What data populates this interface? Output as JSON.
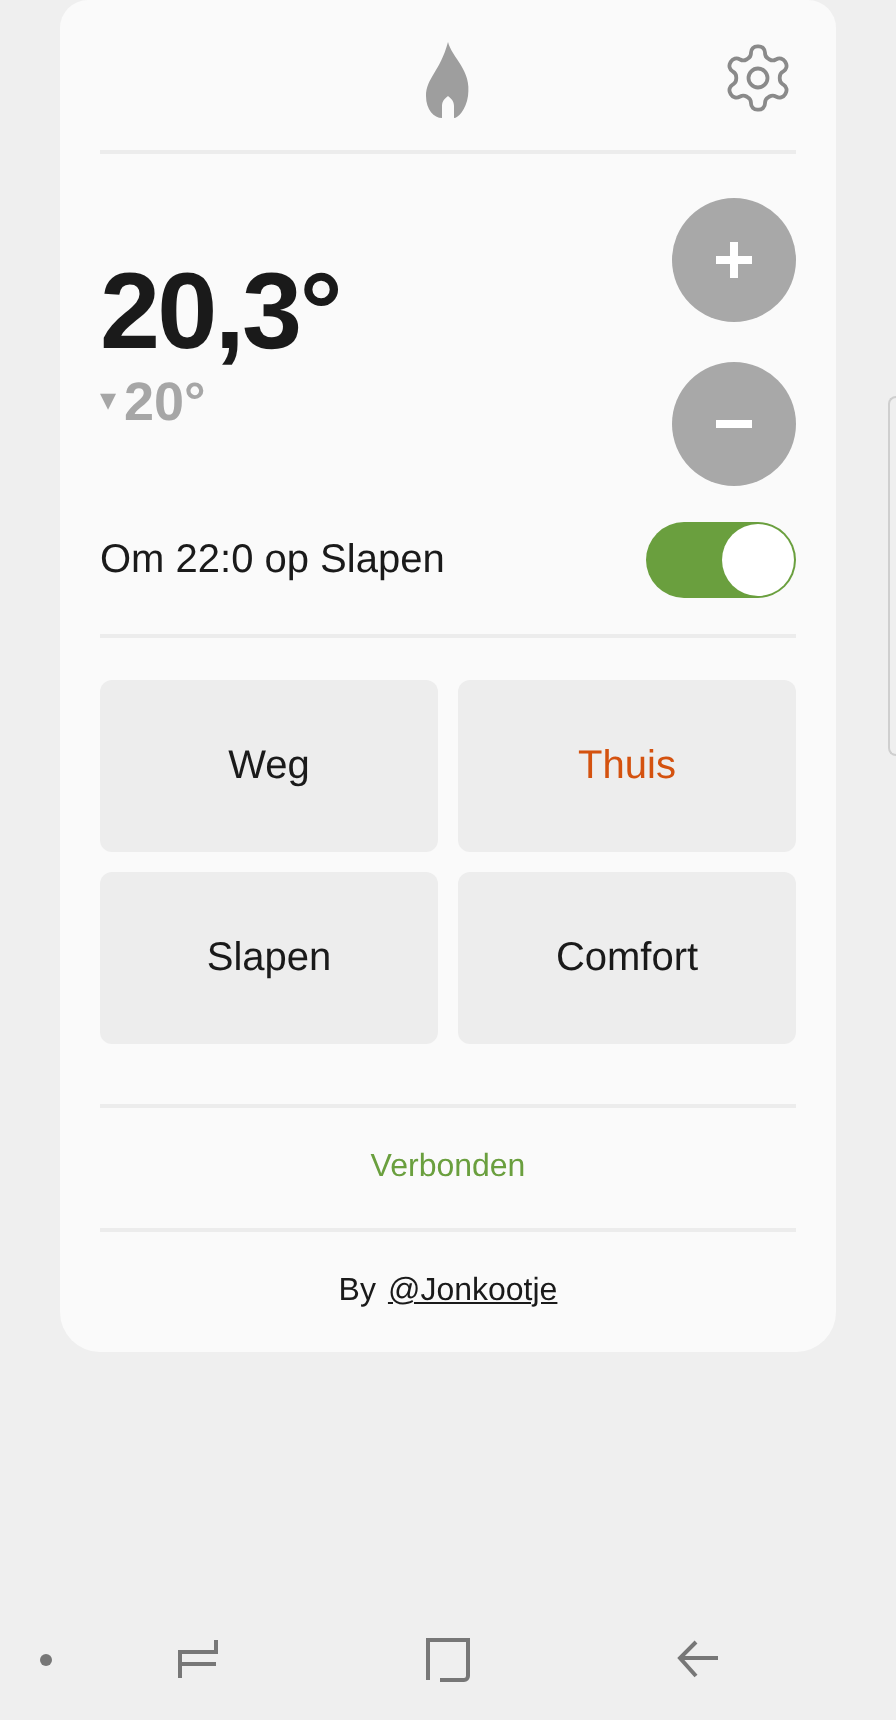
{
  "temperature": "20,3°",
  "setpoint": {
    "arrow": "▾",
    "value": "20°"
  },
  "schedule": {
    "label": "Om 22:0 op Slapen",
    "on": true
  },
  "modes": [
    {
      "label": "Weg",
      "selected": false
    },
    {
      "label": "Thuis",
      "selected": true
    },
    {
      "label": "Slapen",
      "selected": false
    },
    {
      "label": "Comfort",
      "selected": false
    }
  ],
  "status": "Verbonden",
  "credit": {
    "prefix": "By",
    "link": "@Jonkootje"
  }
}
